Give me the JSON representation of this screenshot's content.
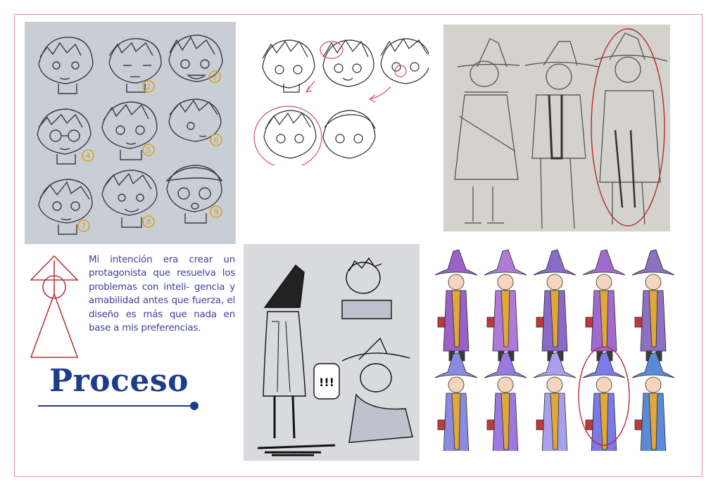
{
  "description": "Mi intención era crear un protagonista que resuelva los problemas con inteli- gencia y amabilidad antes que fuerza, el diseño es más que nada en base a mis preferencias.",
  "title": "Proceso",
  "sketch_numbers": [
    "2",
    "3",
    "4",
    "5",
    "6",
    "7",
    "8",
    "9"
  ],
  "comic_sfx": "!!!",
  "colors": {
    "border": "#e28ab4",
    "title": "#1d3c8e",
    "text": "#3d3d9a",
    "logo": "#b53a3a",
    "number_ink": "#d8a21c",
    "highlight_circle": "#c0263f"
  }
}
